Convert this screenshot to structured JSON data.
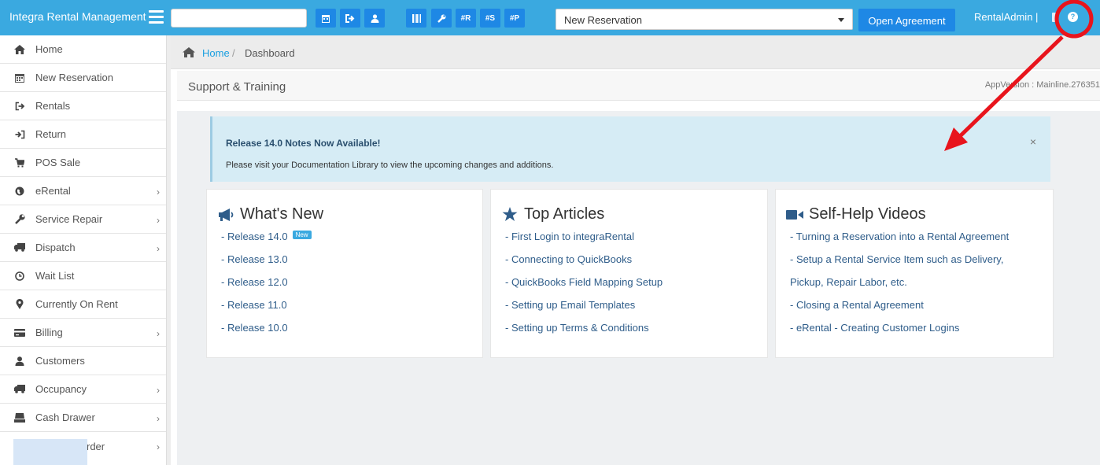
{
  "app": {
    "brand": "Integra Rental Management"
  },
  "toolbar": {
    "buttons": [
      {
        "name": "new-reservation-tool",
        "label": "▦"
      },
      {
        "name": "rentals-tool",
        "label": "⇨"
      },
      {
        "name": "customers-tool",
        "label": "👤"
      },
      {
        "name": "barcode-tool",
        "label": "|||"
      },
      {
        "name": "service-repair-tool",
        "label": "✎"
      },
      {
        "name": "search-reservation-tool",
        "label": "#R"
      },
      {
        "name": "search-sale-tool",
        "label": "#S"
      },
      {
        "name": "search-purchase-tool",
        "label": "#P"
      }
    ],
    "select_value": "New Reservation",
    "open_button": "Open Agreement",
    "user": "RentalAdmin |",
    "help": "?"
  },
  "sidebar": {
    "items": [
      {
        "label": "Home",
        "icon": "home-icon",
        "arrow": false
      },
      {
        "label": "New Reservation",
        "icon": "calendar-icon",
        "arrow": false
      },
      {
        "label": "Rentals",
        "icon": "sign-out-icon",
        "arrow": false
      },
      {
        "label": "Return",
        "icon": "sign-in-icon",
        "arrow": false
      },
      {
        "label": "POS Sale",
        "icon": "cart-icon",
        "arrow": false
      },
      {
        "label": "eRental",
        "icon": "globe-icon",
        "arrow": true
      },
      {
        "label": "Service Repair",
        "icon": "wrench-icon",
        "arrow": true
      },
      {
        "label": "Dispatch",
        "icon": "truck-icon",
        "arrow": true
      },
      {
        "label": "Wait List",
        "icon": "clock-icon",
        "arrow": false
      },
      {
        "label": "Currently On Rent",
        "icon": "map-marker-icon",
        "arrow": false
      },
      {
        "label": "Billing",
        "icon": "credit-card-icon",
        "arrow": true
      },
      {
        "label": "Customers",
        "icon": "user-icon",
        "arrow": false
      },
      {
        "label": "Occupancy",
        "icon": "truck-icon",
        "arrow": true
      },
      {
        "label": "Cash Drawer",
        "icon": "drawer-icon",
        "arrow": true
      },
      {
        "label": "rder",
        "icon": "",
        "arrow": true
      }
    ]
  },
  "breadcrumb": {
    "home": "Home",
    "separator": "/",
    "current": "Dashboard"
  },
  "page": {
    "title": "Support & Training",
    "version": "AppVersion : Mainline.276351"
  },
  "alert": {
    "title": "Release 14.0 Notes Now Available!",
    "text": "Please visit your Documentation Library to view the upcoming changes and additions.",
    "close": "×"
  },
  "cards": {
    "whats_new": {
      "title": "What's New",
      "badge": "New",
      "links": [
        "- Release 14.0",
        "- Release 13.0",
        "- Release 12.0",
        "- Release 11.0",
        "- Release 10.0"
      ]
    },
    "top_articles": {
      "title": "Top Articles",
      "links": [
        "- First Login to integraRental",
        "- Connecting to QuickBooks",
        "- QuickBooks Field Mapping Setup",
        "- Setting up Email Templates",
        "- Setting up Terms & Conditions"
      ]
    },
    "videos": {
      "title": "Self-Help Videos",
      "links": [
        "- Turning a Reservation into a Rental Agreement",
        "- Setup a Rental Service Item such as Delivery,",
        "Pickup, Repair Labor, etc.",
        "- Closing a Rental Agreement",
        "- eRental - Creating Customer Logins"
      ]
    }
  },
  "colors": {
    "topbar": "#3aa9e0",
    "button": "#1e88e5",
    "link": "#2f5d8a",
    "annotation": "#e8141c"
  }
}
